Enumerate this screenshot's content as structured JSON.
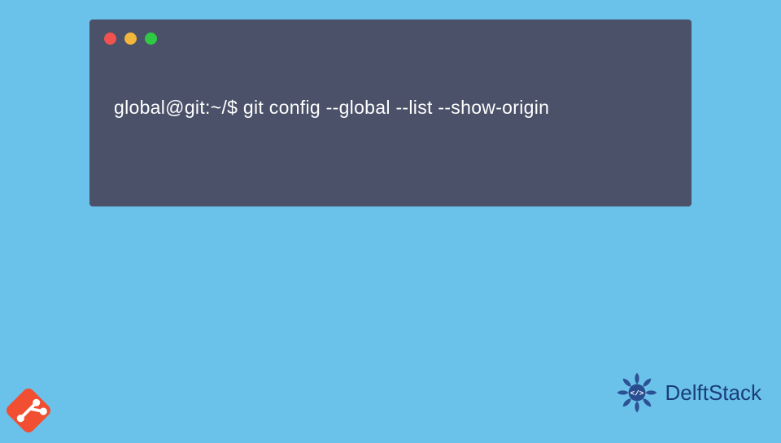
{
  "terminal": {
    "prompt": "global@git:~/$ ",
    "command": "git config --global --list --show-origin"
  },
  "branding": {
    "site_name": "DelftStack"
  },
  "colors": {
    "page_bg": "#6ac1ea",
    "terminal_bg": "#4a5168",
    "dot_red": "#f0524f",
    "dot_yellow": "#f3b63c",
    "dot_green": "#2fc944",
    "git_logo": "#f14e32",
    "delft_emblem": "#2a4d8f",
    "delft_text": "#1b3e7a"
  }
}
